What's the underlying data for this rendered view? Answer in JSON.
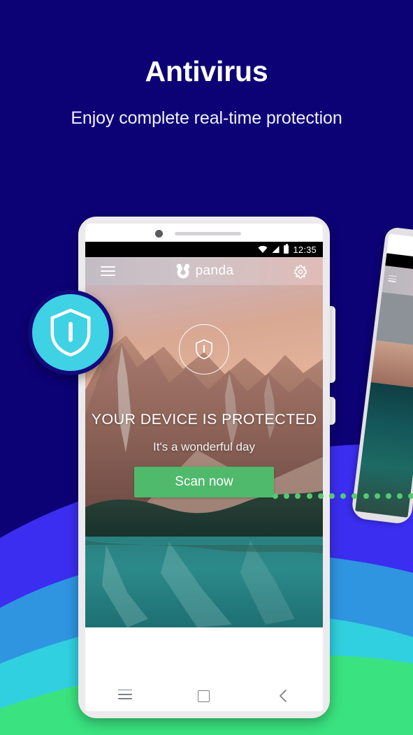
{
  "page": {
    "title": "Antivirus",
    "subtitle": "Enjoy complete real-time protection",
    "background_color": "#0d0176"
  },
  "colors": {
    "background_navy": "#0d0176",
    "wave_indigo": "#3b2ef0",
    "wave_blue": "#2f95e0",
    "wave_cyan": "#31d0e0",
    "wave_green": "#3ae37f",
    "badge_cyan": "#3fd1e4",
    "scan_button_green": "#4fb96c",
    "dot_green": "#54c971"
  },
  "badge": {
    "icon": "shield-icon"
  },
  "phone": {
    "status_bar": {
      "time": "12:35",
      "icons": [
        "wifi-icon",
        "signal-icon",
        "battery-icon"
      ]
    },
    "app_bar": {
      "menu_icon": "hamburger-menu-icon",
      "brand": "panda",
      "brand_mark_icon": "panda-logo-icon",
      "settings_icon": "gear-icon"
    },
    "screen": {
      "status_icon": "shield-icon",
      "title": "YOUR DEVICE IS PROTECTED",
      "subtitle": "It's a wonderful day",
      "scan_button_label": "Scan now",
      "scroll_hint_icon": "double-chevron-down-icon"
    },
    "nav_bar": {
      "recents_icon": "recents-menu-icon",
      "home_icon": "home-square-icon",
      "back_icon": "back-chevron-icon"
    }
  },
  "secondary_phone": {
    "present": true
  },
  "decoration": {
    "dot_count": 25
  }
}
